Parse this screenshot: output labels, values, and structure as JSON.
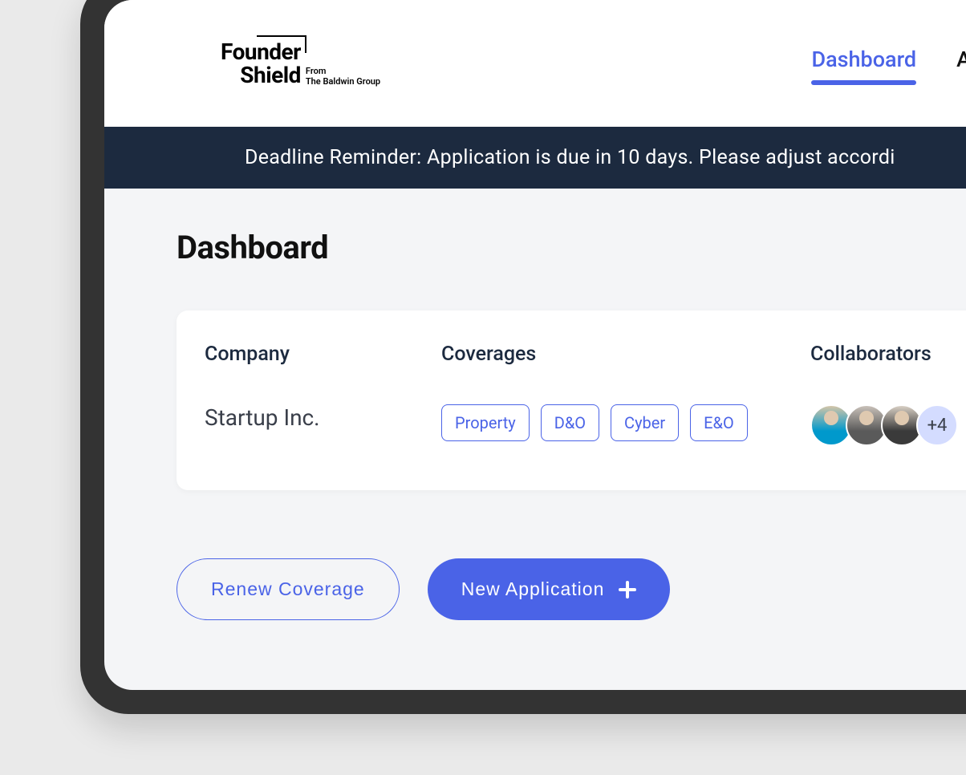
{
  "logo": {
    "line1": "Founder",
    "line2": "Shield",
    "sub_line1": "From",
    "sub_line2": "The Baldwin Group"
  },
  "nav": {
    "items": [
      {
        "label": "Dashboard",
        "active": true
      },
      {
        "label": "A",
        "active": false
      }
    ]
  },
  "banner": {
    "text": "Deadline Reminder: Application is due in 10 days. Please adjust accordi"
  },
  "page": {
    "title": "Dashboard"
  },
  "card": {
    "company_label": "Company",
    "coverages_label": "Coverages",
    "collab_label": "Collaborators",
    "company_name": "Startup Inc.",
    "coverages": [
      "Property",
      "D&O",
      "Cyber",
      "E&O"
    ],
    "collab_more": "+4"
  },
  "actions": {
    "renew": "Renew Coverage",
    "new_app": "New Application"
  }
}
